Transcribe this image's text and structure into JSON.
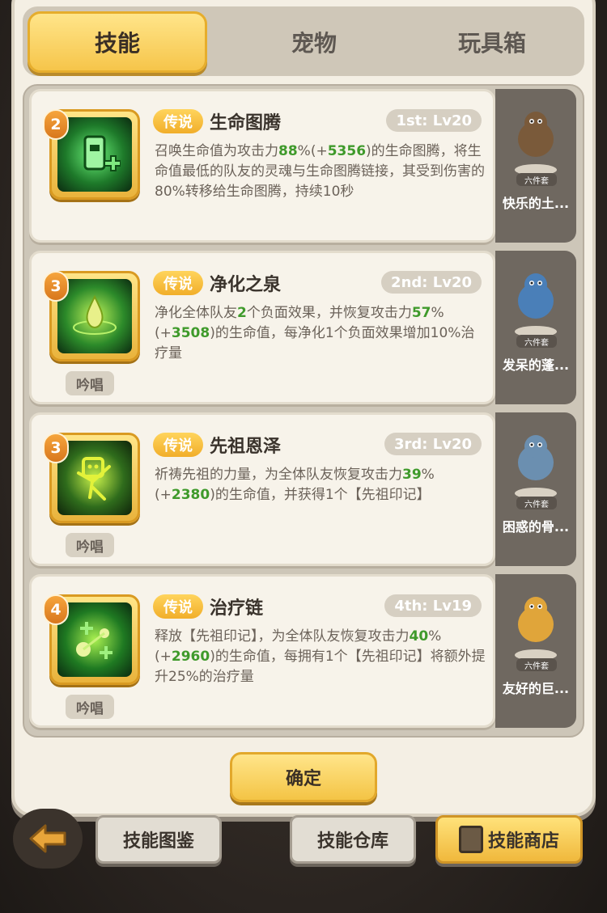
{
  "tabs": [
    {
      "label": "技能",
      "active": true
    },
    {
      "label": "宠物",
      "active": false
    },
    {
      "label": "玩具箱",
      "active": false
    }
  ],
  "skills": [
    {
      "number": "2",
      "rarity": "传说",
      "name": "生命图腾",
      "level": "1st: Lv20",
      "chant": "",
      "desc_parts": [
        {
          "t": "召唤生命值为攻击力"
        },
        {
          "t": "88",
          "g": true
        },
        {
          "t": "%(+"
        },
        {
          "t": "5356",
          "g": true
        },
        {
          "t": ")的生命图腾，将生命值最低的队友的灵魂与生命图腾链接，其受到伤害的80%转移给生命图腾，持续10秒"
        }
      ]
    },
    {
      "number": "3",
      "rarity": "传说",
      "name": "净化之泉",
      "level": "2nd: Lv20",
      "chant": "吟唱",
      "desc_parts": [
        {
          "t": "净化全体队友"
        },
        {
          "t": "2",
          "g": true
        },
        {
          "t": "个负面效果，并恢复攻击力"
        },
        {
          "t": "57",
          "g": true
        },
        {
          "t": "%(+"
        },
        {
          "t": "3508",
          "g": true
        },
        {
          "t": ")的生命值，每净化1个负面效果增加10%治疗量"
        }
      ]
    },
    {
      "number": "3",
      "rarity": "传说",
      "name": "先祖恩泽",
      "level": "3rd: Lv20",
      "chant": "吟唱",
      "desc_parts": [
        {
          "t": "祈祷先祖的力量，为全体队友恢复攻击力"
        },
        {
          "t": "39",
          "g": true
        },
        {
          "t": "%(+"
        },
        {
          "t": "2380",
          "g": true
        },
        {
          "t": ")的生命值，并获得1个【先祖印记】"
        }
      ]
    },
    {
      "number": "4",
      "rarity": "传说",
      "name": "治疗链",
      "level": "4th: Lv19",
      "chant": "吟唱",
      "desc_parts": [
        {
          "t": "释放【先祖印记】，为全体队友恢复攻击力"
        },
        {
          "t": "40",
          "g": true
        },
        {
          "t": "%(+"
        },
        {
          "t": "2960",
          "g": true
        },
        {
          "t": ")的生命值，每拥有1个【先祖印记】将额外提升25%的治疗量"
        }
      ]
    }
  ],
  "pets": [
    {
      "badge": "六件套",
      "name": "快乐的土..."
    },
    {
      "badge": "六件套",
      "name": "发呆的蓬..."
    },
    {
      "badge": "六件套",
      "name": "困惑的骨..."
    },
    {
      "badge": "六件套",
      "name": "友好的巨..."
    }
  ],
  "confirm_label": "确定",
  "bottom_nav": {
    "skill_catalog": "技能图鉴",
    "skill_storage": "技能仓库",
    "skill_shop": "技能商店"
  }
}
